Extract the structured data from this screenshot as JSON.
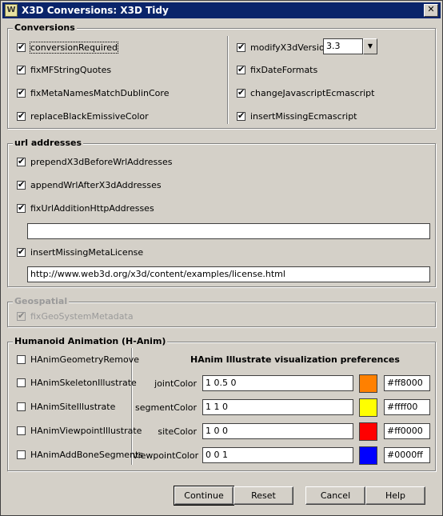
{
  "window": {
    "title": "X3D Conversions:  X3D Tidy",
    "close": "✕"
  },
  "conversions": {
    "legend": "Conversions",
    "left": [
      {
        "label": "conversionRequired",
        "checked": true
      },
      {
        "label": "fixMFStringQuotes",
        "checked": true
      },
      {
        "label": "fixMetaNamesMatchDublinCore",
        "checked": true
      },
      {
        "label": "replaceBlackEmissiveColor",
        "checked": true
      }
    ],
    "right": [
      {
        "label": "modifyX3dVersion",
        "checked": true
      },
      {
        "label": "fixDateFormats",
        "checked": true
      },
      {
        "label": "changeJavascriptEcmascript",
        "checked": true
      },
      {
        "label": "insertMissingEcmascript",
        "checked": true
      }
    ],
    "version_value": "3.3"
  },
  "url": {
    "legend": "url addresses",
    "items": [
      {
        "label": "prependX3dBeforeWrlAddresses",
        "checked": true
      },
      {
        "label": "appendWrlAfterX3dAddresses",
        "checked": true
      },
      {
        "label": "fixUrlAdditionHttpAddresses",
        "checked": true
      }
    ],
    "http_field": "",
    "license": {
      "label": "insertMissingMetaLicense",
      "checked": true
    },
    "license_field": "http://www.web3d.org/x3d/content/examples/license.html"
  },
  "geo": {
    "legend": "Geospatial",
    "item": {
      "label": "fixGeoSystemMetadata",
      "checked": true
    }
  },
  "hanim": {
    "legend": "Humanoid Animation (H-Anim)",
    "items": [
      {
        "label": "HAnimGeometryRemove",
        "checked": false
      },
      {
        "label": "HAnimSkeletonIllustrate",
        "checked": false
      },
      {
        "label": "HAnimSiteIllustrate",
        "checked": false
      },
      {
        "label": "HAnimViewpointIllustrate",
        "checked": false
      },
      {
        "label": "HAnimAddBoneSegments",
        "checked": false
      }
    ],
    "prefs_title": "HAnim Illustrate visualization preferences",
    "colors": [
      {
        "label": "jointColor",
        "value": "1 0.5 0",
        "hex": "#ff8000",
        "swatch": "#ff8000"
      },
      {
        "label": "segmentColor",
        "value": "1 1 0",
        "hex": "#ffff00",
        "swatch": "#ffff00"
      },
      {
        "label": "siteColor",
        "value": "1 0 0",
        "hex": "#ff0000",
        "swatch": "#ff0000"
      },
      {
        "label": "viewpointColor",
        "value": "0 0 1",
        "hex": "#0000ff",
        "swatch": "#0000ff"
      }
    ]
  },
  "buttons": {
    "continue": "Continue",
    "reset": "Reset",
    "cancel": "Cancel",
    "help": "Help"
  }
}
